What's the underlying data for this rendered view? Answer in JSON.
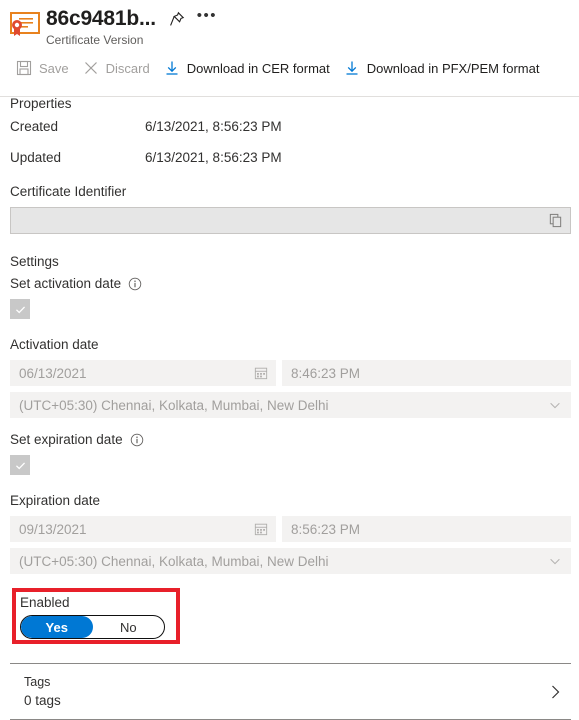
{
  "header": {
    "icon": "certificate-icon",
    "title": "86c9481b...",
    "subtitle": "Certificate Version",
    "pin_icon": "pin-icon",
    "more_icon": "ellipsis-icon"
  },
  "toolbar": {
    "save_label": "Save",
    "discard_label": "Discard",
    "download_cer_label": "Download in CER format",
    "download_pfx_label": "Download in PFX/PEM format"
  },
  "properties": {
    "heading": "Properties",
    "rows": [
      {
        "label": "Created",
        "value": "6/13/2021, 8:56:23 PM"
      },
      {
        "label": "Updated",
        "value": "6/13/2021, 8:56:23 PM"
      }
    ]
  },
  "certificate_identifier": {
    "label": "Certificate Identifier",
    "value": "",
    "copy_icon": "copy-icon"
  },
  "settings": {
    "heading": "Settings",
    "activation": {
      "checkbox_label": "Set activation date",
      "checked": "true",
      "date_label": "Activation date",
      "date_value": "06/13/2021",
      "time_value": "8:46:23 PM",
      "timezone_value": "(UTC+05:30) Chennai, Kolkata, Mumbai, New Delhi"
    },
    "expiration": {
      "checkbox_label": "Set expiration date",
      "checked": "true",
      "date_label": "Expiration date",
      "date_value": "09/13/2021",
      "time_value": "8:56:23 PM",
      "timezone_value": "(UTC+05:30) Chennai, Kolkata, Mumbai, New Delhi"
    },
    "enabled": {
      "label": "Enabled",
      "yes_label": "Yes",
      "no_label": "No",
      "selected": "Yes",
      "highlight_color": "#e8202a",
      "accent_color": "#0078d4"
    }
  },
  "tags": {
    "title": "Tags",
    "count_label": "0 tags",
    "chevron_icon": "chevron-right-icon"
  }
}
